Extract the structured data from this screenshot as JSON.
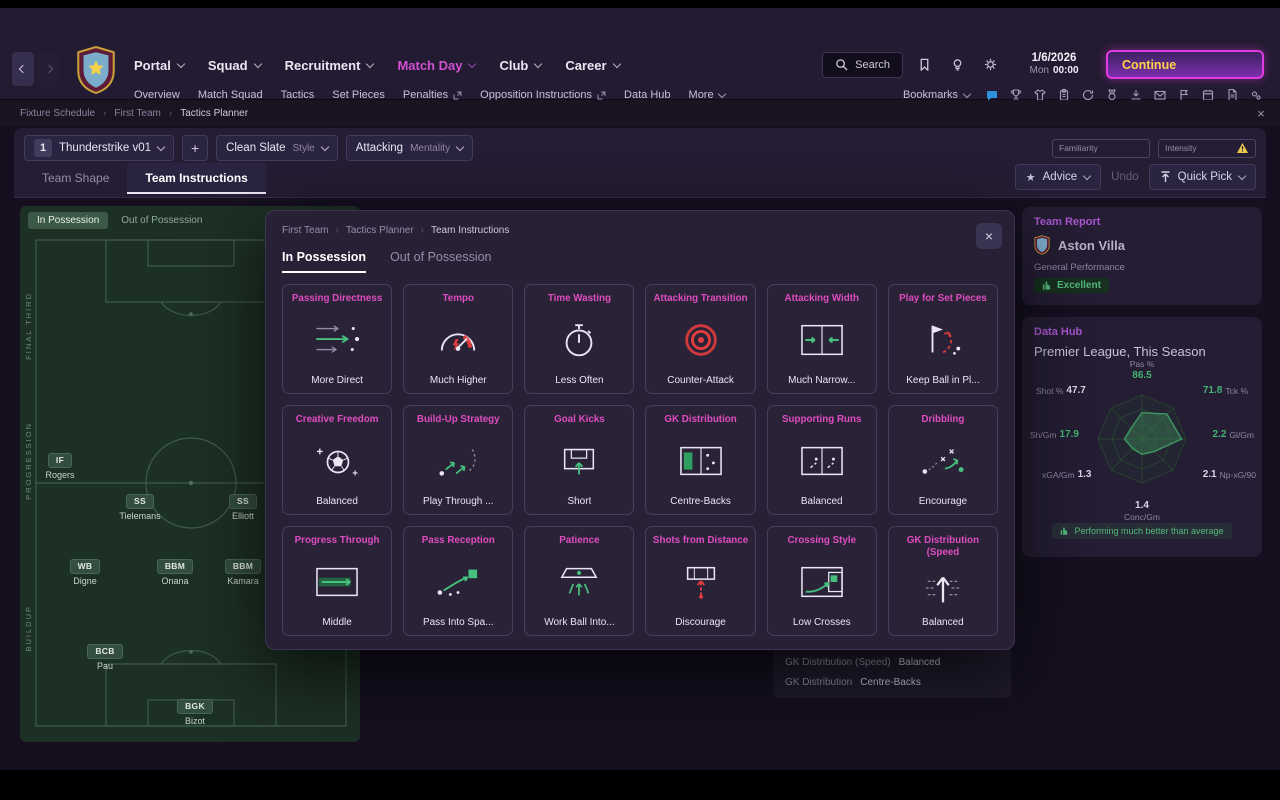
{
  "top_nav": {
    "menus": [
      {
        "label": "Portal"
      },
      {
        "label": "Squad"
      },
      {
        "label": "Recruitment"
      },
      {
        "label": "Match Day",
        "active": true
      },
      {
        "label": "Club"
      },
      {
        "label": "Career"
      }
    ],
    "search_label": "Search",
    "icons": [
      "bookmark",
      "hint-bulb",
      "settings-gear"
    ],
    "date": "1/6/2026",
    "day": "Mon",
    "time": "00:00",
    "continue_label": "Continue"
  },
  "sub_nav": {
    "items": [
      {
        "label": "Overview"
      },
      {
        "label": "Match Squad"
      },
      {
        "label": "Tactics"
      },
      {
        "label": "Set Pieces"
      },
      {
        "label": "Penalties",
        "external": true
      },
      {
        "label": "Opposition Instructions",
        "external": true
      },
      {
        "label": "Data Hub"
      },
      {
        "label": "More",
        "dropdown": true
      }
    ],
    "bookmarks_label": "Bookmarks",
    "icons": [
      "chat",
      "trophy",
      "shirt",
      "clipboard",
      "refresh",
      "medal",
      "download",
      "mail",
      "flag",
      "calendar",
      "document",
      "gear"
    ]
  },
  "breadcrumb": {
    "items": [
      "Fixture Schedule",
      "First Team",
      "Tactics Planner"
    ]
  },
  "toolbar": {
    "tactic_index": "1",
    "tactic_name": "Thunderstrike v01",
    "add_button": "+",
    "style_value": "Clean Slate",
    "style_label": "Style",
    "mentality_value": "Attacking",
    "mentality_label": "Mentality",
    "familiarity_label": "Familiarity",
    "intensity_label": "Intensity"
  },
  "view_tabs": {
    "team_shape": "Team Shape",
    "team_instructions": "Team Instructions",
    "advice_label": "Advice",
    "undo_label": "Undo",
    "quick_pick_label": "Quick Pick"
  },
  "pitch": {
    "tabs": {
      "in_possession": "In Possession",
      "out_of_possession": "Out of Possession"
    },
    "zones": [
      "FINAL THIRD",
      "PROGRESSION",
      "BUILDUP"
    ],
    "players": [
      {
        "role": "IF",
        "name": "Rogers"
      },
      {
        "role": "SS",
        "name": "Tielemans"
      },
      {
        "role": "SS",
        "name": "Elliott"
      },
      {
        "role": "WB",
        "name": "Digne"
      },
      {
        "role": "BBM",
        "name": "Onana"
      },
      {
        "role": "BBM",
        "name": "Kamara"
      },
      {
        "role": "BCB",
        "name": "Pau"
      },
      {
        "role": "BGK",
        "name": "Bizot"
      }
    ]
  },
  "modal": {
    "breadcrumb": [
      "First Team",
      "Tactics Planner",
      "Team Instructions"
    ],
    "tabs": {
      "in_possession": "In Possession",
      "out_of_possession": "Out of Possession"
    },
    "cards": [
      {
        "title": "Passing Directness",
        "value": "More Direct"
      },
      {
        "title": "Tempo",
        "value": "Much Higher"
      },
      {
        "title": "Time Wasting",
        "value": "Less Often"
      },
      {
        "title": "Attacking Transition",
        "value": "Counter-Attack"
      },
      {
        "title": "Attacking Width",
        "value": "Much Narrow..."
      },
      {
        "title": "Play for Set Pieces",
        "value": "Keep Ball in Pl..."
      },
      {
        "title": "Creative Freedom",
        "value": "Balanced"
      },
      {
        "title": "Build-Up Strategy",
        "value": "Play Through ..."
      },
      {
        "title": "Goal Kicks",
        "value": "Short"
      },
      {
        "title": "GK Distribution",
        "value": "Centre-Backs"
      },
      {
        "title": "Supporting Runs",
        "value": "Balanced"
      },
      {
        "title": "Dribbling",
        "value": "Encourage"
      },
      {
        "title": "Progress Through",
        "value": "Middle"
      },
      {
        "title": "Pass Reception",
        "value": "Pass Into Spa..."
      },
      {
        "title": "Patience",
        "value": "Work Ball Into..."
      },
      {
        "title": "Shots from Distance",
        "value": "Discourage"
      },
      {
        "title": "Crossing Style",
        "value": "Low Crosses"
      },
      {
        "title": "GK Distribution (Speed",
        "value": "Balanced"
      }
    ]
  },
  "team_report": {
    "title": "Team Report",
    "club_name": "Aston Villa",
    "section_label": "General Performance",
    "rating": "Excellent"
  },
  "data_hub": {
    "title": "Data Hub",
    "subtitle": "Premier League, This Season",
    "note": "Performing much better than average",
    "stats": [
      {
        "label": "Pas %",
        "value": "86.5",
        "positive": true
      },
      {
        "label": "Shot %",
        "value": "47.7",
        "positive": false
      },
      {
        "label": "Tck %",
        "value": "71.8",
        "positive": true
      },
      {
        "label": "Sh/Gm",
        "value": "17.9",
        "positive": true
      },
      {
        "label": "Gl/Gm",
        "value": "2.2",
        "positive": true
      },
      {
        "label": "xGA/Gm",
        "value": "1.3",
        "positive": false
      },
      {
        "label": "Np-xG/90",
        "value": "2.1",
        "positive": false
      },
      {
        "label": "Conc/Gm",
        "value": "1.4",
        "positive": false
      }
    ],
    "chart_data": {
      "type": "radar",
      "title": "Premier League, This Season",
      "axes": [
        "Pas %",
        "Tck %",
        "Gl/Gm",
        "Np-xG/90",
        "Conc/Gm",
        "xGA/Gm",
        "Sh/Gm",
        "Shot %"
      ],
      "values": [
        86.5,
        71.8,
        2.2,
        2.1,
        1.4,
        1.3,
        17.9,
        47.7
      ]
    }
  },
  "background_panel": {
    "rows": [
      {
        "label": "GK Distribution (Speed)",
        "value": "Balanced"
      },
      {
        "label": "GK Distribution",
        "value": "Centre-Backs"
      }
    ]
  },
  "colors": {
    "accent_magenta": "#d14fd1",
    "card_title_pink": "#df4cc0",
    "positive_green": "#43b374",
    "warning_yellow": "#ecc94b",
    "alert_red": "#e23d3d",
    "continue_text_gold": "#ffd24a"
  }
}
